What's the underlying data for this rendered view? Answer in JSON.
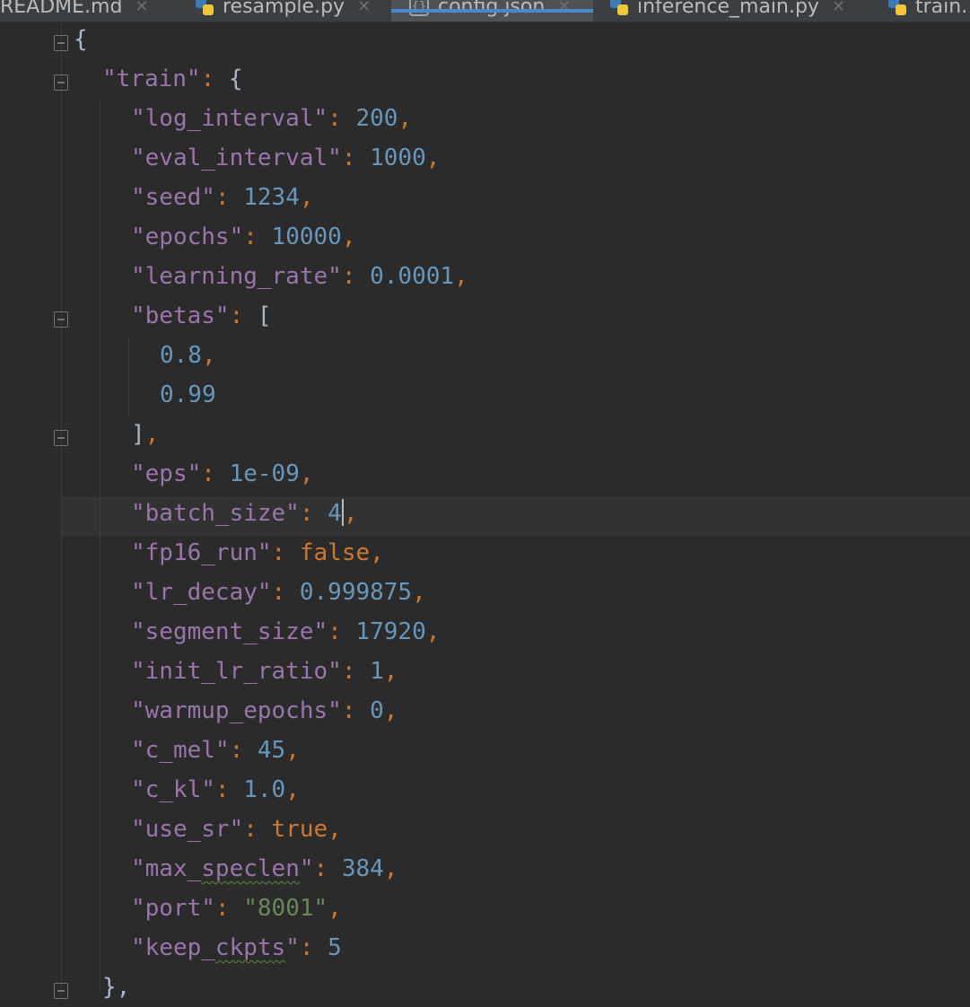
{
  "tabs": [
    {
      "label": "README.md",
      "icon": "markdown-icon",
      "active": false
    },
    {
      "label": "resample.py",
      "icon": "python-file-icon",
      "active": false
    },
    {
      "label": "config.json",
      "icon": "json-file-icon",
      "active": true
    },
    {
      "label": "inference_main.py",
      "icon": "python-file-icon",
      "active": false
    },
    {
      "label": "train.",
      "icon": "python-file-icon",
      "active": false
    }
  ],
  "code": {
    "open_brace": "{",
    "train_key": "\"train\"",
    "train_open": "{",
    "entries": [
      {
        "key": "\"log_interval\"",
        "value": "200",
        "type": "num",
        "comma": ","
      },
      {
        "key": "\"eval_interval\"",
        "value": "1000",
        "type": "num",
        "comma": ","
      },
      {
        "key": "\"seed\"",
        "value": "1234",
        "type": "num",
        "comma": ","
      },
      {
        "key": "\"epochs\"",
        "value": "10000",
        "type": "num",
        "comma": ","
      },
      {
        "key": "\"learning_rate\"",
        "value": "0.0001",
        "type": "num",
        "comma": ","
      }
    ],
    "betas_key": "\"betas\"",
    "betas_open": "[",
    "betas_values": [
      "0.8",
      "0.99"
    ],
    "betas_close": "]",
    "entries_after": [
      {
        "key": "\"eps\"",
        "value": "1e-09",
        "type": "num",
        "comma": ","
      },
      {
        "key": "\"batch_size\"",
        "value": "4",
        "type": "num",
        "comma": ","
      },
      {
        "key": "\"fp16_run\"",
        "value": "false",
        "type": "kw",
        "comma": ","
      },
      {
        "key": "\"lr_decay\"",
        "value": "0.999875",
        "type": "num",
        "comma": ","
      },
      {
        "key": "\"segment_size\"",
        "value": "17920",
        "type": "num",
        "comma": ","
      },
      {
        "key": "\"init_lr_ratio\"",
        "value": "1",
        "type": "num",
        "comma": ","
      },
      {
        "key": "\"warmup_epochs\"",
        "value": "0",
        "type": "num",
        "comma": ","
      },
      {
        "key": "\"c_mel\"",
        "value": "45",
        "type": "num",
        "comma": ","
      },
      {
        "key": "\"c_kl\"",
        "value": "1.0",
        "type": "num",
        "comma": ","
      },
      {
        "key": "\"use_sr\"",
        "value": "true",
        "type": "kw",
        "comma": ","
      },
      {
        "key": "\"max_speclen\"",
        "value": "384",
        "type": "num",
        "comma": ","
      },
      {
        "key": "\"port\"",
        "value": "\"8001\"",
        "type": "str",
        "comma": ","
      },
      {
        "key": "\"keep_ckpts\"",
        "value": "5",
        "type": "num",
        "comma": ""
      }
    ],
    "train_close": "},"
  },
  "colors": {
    "background": "#2b2b2b",
    "key": "#9876aa",
    "number": "#6897bb",
    "keyword": "#cc7832",
    "string": "#6a8759",
    "active_tab_underline": "#4a88c7"
  }
}
